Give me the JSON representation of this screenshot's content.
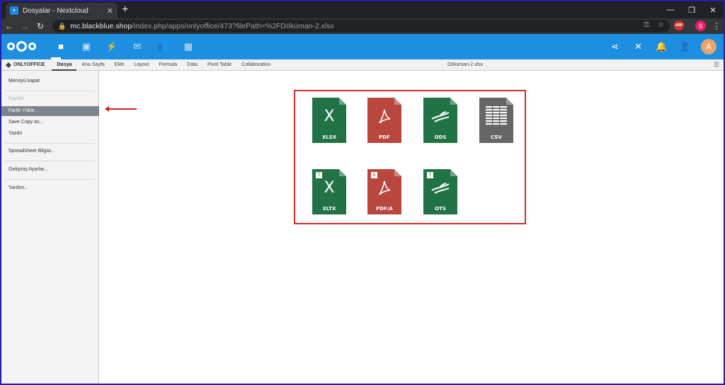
{
  "browser": {
    "tab_title": "Dosyalar - Nextcloud",
    "new_tab": "+",
    "url_host": "mc.blackblue.shop",
    "url_path": "/index.php/apps/onlyoffice/473?filePath=%2FDöküman-2.xlsx",
    "abp_label": "ABP",
    "profile_initial": "S"
  },
  "nextcloud": {
    "avatar_initial": "A"
  },
  "onlyoffice": {
    "brand": "ONLYOFFICE",
    "tabs": [
      "Dosya",
      "Ana Sayfa",
      "Ekle",
      "Layout",
      "Formula",
      "Data",
      "Pivot Table",
      "Collaboration"
    ],
    "doc_name": "Döküman-2.xlsx"
  },
  "file_menu": {
    "close": "Menüyü kapat",
    "save": "Kaydet",
    "save_as": "Farklı Yükle...",
    "save_copy": "Save Copy as...",
    "print": "Yazdır",
    "info": "Spreadsheet Bilgisi...",
    "advanced": "Gelişmiş Ayarlar...",
    "help": "Yardım..."
  },
  "formats": [
    {
      "label": "XLSX",
      "color": "#217346",
      "glyph": "X",
      "template": false
    },
    {
      "label": "PDF",
      "color": "#b9473e",
      "glyph": "pdf",
      "template": false
    },
    {
      "label": "ODS",
      "color": "#217346",
      "glyph": "gull",
      "template": false
    },
    {
      "label": "CSV",
      "color": "#666666",
      "glyph": "grid",
      "template": false
    },
    {
      "label": "XLTX",
      "color": "#217346",
      "glyph": "X",
      "template": true,
      "badge": "T"
    },
    {
      "label": "PDF/A",
      "color": "#b9473e",
      "glyph": "pdf",
      "template": true,
      "badge": "A"
    },
    {
      "label": "OTS",
      "color": "#217346",
      "glyph": "gull",
      "template": true,
      "badge": "T"
    }
  ]
}
